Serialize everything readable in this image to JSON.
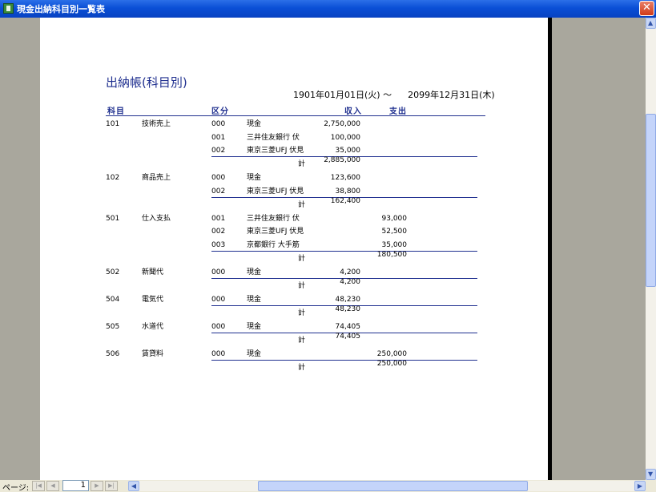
{
  "window": {
    "title": "現金出納科目別一覧表",
    "close_label": "✕"
  },
  "report": {
    "title": "出納帳(科目別)",
    "period_start": "1901年01月01日(火) ～",
    "period_end": "2099年12月31日(木)",
    "headers": {
      "account": "科目",
      "section": "区分",
      "income": "収入",
      "expense": "支出"
    },
    "total_label": "計",
    "groups": [
      {
        "code": "101",
        "name": "技術売上",
        "rows": [
          {
            "sub": "000",
            "desc": "現金",
            "income": "2,750,000",
            "expense": ""
          },
          {
            "sub": "001",
            "desc": "三井住友銀行 伏",
            "income": "100,000",
            "expense": ""
          },
          {
            "sub": "002",
            "desc": "東京三菱UFJ 伏見",
            "income": "35,000",
            "expense": ""
          }
        ],
        "total_income": "2,885,000",
        "total_expense": ""
      },
      {
        "code": "102",
        "name": "商品売上",
        "rows": [
          {
            "sub": "000",
            "desc": "現金",
            "income": "123,600",
            "expense": ""
          },
          {
            "sub": "002",
            "desc": "東京三菱UFJ 伏見",
            "income": "38,800",
            "expense": ""
          }
        ],
        "total_income": "162,400",
        "total_expense": ""
      },
      {
        "code": "501",
        "name": "仕入支払",
        "rows": [
          {
            "sub": "001",
            "desc": "三井住友銀行 伏",
            "income": "",
            "expense": "93,000"
          },
          {
            "sub": "002",
            "desc": "東京三菱UFJ 伏見",
            "income": "",
            "expense": "52,500"
          },
          {
            "sub": "003",
            "desc": "京都銀行 大手筋",
            "income": "",
            "expense": "35,000"
          }
        ],
        "total_income": "",
        "total_expense": "180,500"
      },
      {
        "code": "502",
        "name": "新聞代",
        "rows": [
          {
            "sub": "000",
            "desc": "現金",
            "income": "4,200",
            "expense": ""
          }
        ],
        "total_income": "4,200",
        "total_expense": ""
      },
      {
        "code": "504",
        "name": "電気代",
        "rows": [
          {
            "sub": "000",
            "desc": "現金",
            "income": "48,230",
            "expense": ""
          }
        ],
        "total_income": "48,230",
        "total_expense": ""
      },
      {
        "code": "505",
        "name": "水道代",
        "rows": [
          {
            "sub": "000",
            "desc": "現金",
            "income": "74,405",
            "expense": ""
          }
        ],
        "total_income": "74,405",
        "total_expense": ""
      },
      {
        "code": "506",
        "name": "賃貸料",
        "rows": [
          {
            "sub": "000",
            "desc": "現金",
            "income": "",
            "expense": "250,000"
          }
        ],
        "total_income": "",
        "total_expense": "250,000"
      }
    ]
  },
  "statusbar": {
    "page_label": "ページ:",
    "page_number": "1",
    "first_icon": "first-page-icon",
    "prev_icon": "prev-page-icon",
    "next_icon": "next-page-icon",
    "last_icon": "last-page-icon"
  }
}
